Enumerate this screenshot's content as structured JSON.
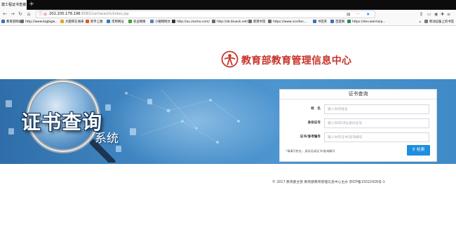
{
  "browser": {
    "tab_title": "建工程证书查询",
    "tab_close": "×",
    "new_tab": "+",
    "url_host": "202.205.178.196",
    "url_path": ":8081/certsearch/index.jsp",
    "bookmarks": [
      {
        "label": "教育部网站",
        "color": "#3b6fb6"
      },
      {
        "label": "http://www.bigbigw...",
        "color": "#6a6a6a"
      },
      {
        "label": "大题库在线采",
        "color": "#e1a32a"
      },
      {
        "label": "新手上路",
        "color": "#e2571c"
      },
      {
        "label": "常用网址",
        "color": "#3478c6"
      },
      {
        "label": "农业网络",
        "color": "#4c9a3a"
      },
      {
        "label": "小植物网文",
        "color": "#5a7fb7"
      },
      {
        "label": "http://ou.znzmo.com/",
        "color": "#333333"
      },
      {
        "label": "http://zb.bluesk.net/...",
        "color": "#6a6a6a"
      },
      {
        "label": "新建书签",
        "color": "#6a6a6a"
      },
      {
        "label": "https://www.iconfon...",
        "color": "#6a6a6a"
      },
      {
        "label": "书签夹",
        "color": "#3b6fb6"
      },
      {
        "label": "百度网",
        "color": "#3b6fb6"
      },
      {
        "label": "https://dev.weimaip...",
        "color": "#2d8a4a"
      }
    ],
    "bookmarks_more": "»",
    "mobile_bookmarks": "移动设备上的书签"
  },
  "header": {
    "org_name": "教育部教育管理信息中心",
    "brand_color": "#c8332b"
  },
  "banner": {
    "title": "证书查询",
    "subtitle": "系统"
  },
  "search_panel": {
    "heading": "证书查询",
    "fields": [
      {
        "label": "姓　名",
        "placeholder": "输入你的姓名"
      },
      {
        "label": "身份证号",
        "placeholder": "输入你的18位身份证号"
      },
      {
        "label": "证书/准考编号",
        "placeholder": "输入你的证书/查询编号"
      }
    ],
    "note": "*请填写姓名，身份证或证书/查询编号",
    "search_button": "检索",
    "button_color": "#1d8ee0"
  },
  "footer": {
    "text": "© 2017 教育部主管 教育部教育管理信息中心主办 京ICP备15022426号-1"
  }
}
